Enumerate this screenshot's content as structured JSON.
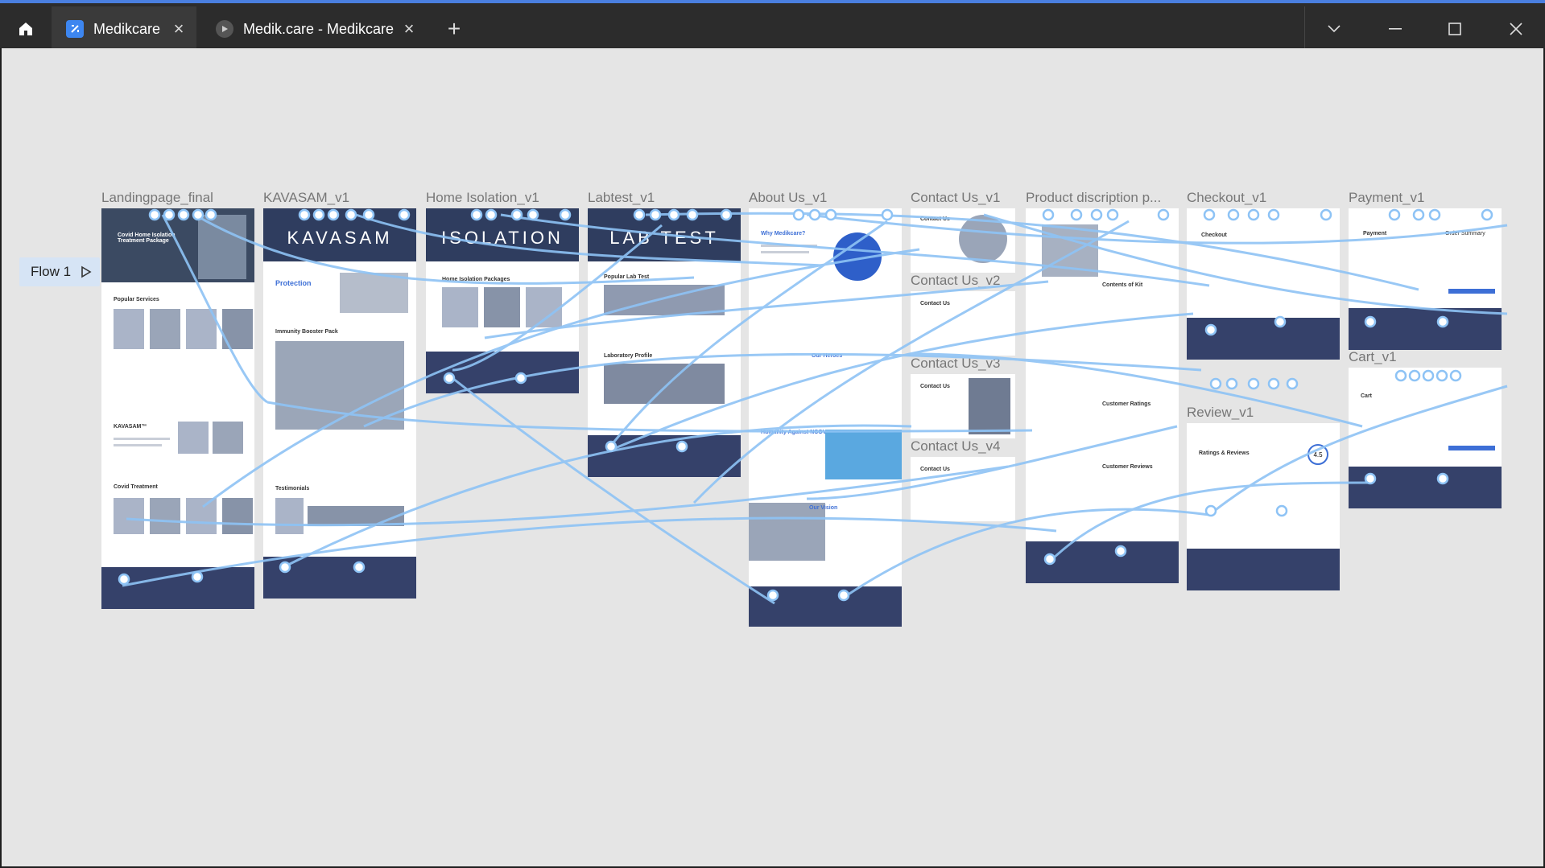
{
  "browser": {
    "tabs": [
      {
        "label": "Medikcare",
        "icon": "figma-file-icon",
        "active": true
      },
      {
        "label": "Medik.care - Medikcare",
        "icon": "play-icon",
        "active": false
      }
    ],
    "new_tab": "+"
  },
  "canvas": {
    "flow_label": "Flow 1",
    "frames": [
      {
        "title": "Landingpage_final",
        "hero": "Covid Home Isolation Treatment Package",
        "sections": [
          "Popular Services",
          "KAVASAM™",
          "Covid Treatment"
        ]
      },
      {
        "title": "KAVASAM_v1",
        "hero": "KAVASAM",
        "sections": [
          "Protection",
          "Immunity Booster Pack",
          "Testimonials"
        ]
      },
      {
        "title": "Home Isolation_v1",
        "hero": "ISOLATION",
        "sections": [
          "Home Isolation Packages"
        ]
      },
      {
        "title": "Labtest_v1",
        "hero": "LAB TEST",
        "sections": [
          "Popular Lab Test",
          "Laboratory Profile"
        ]
      },
      {
        "title": "About Us_v1",
        "hero": "Why Medikcare?",
        "sections": [
          "Our Heroes",
          "Humanity Against NCOVID",
          "Our Vision"
        ]
      },
      {
        "title": "Contact Us_v1",
        "hero": "Contact Us",
        "sections": []
      },
      {
        "title": "Contact Us_v2",
        "hero": "Contact Us",
        "sections": []
      },
      {
        "title": "Contact Us_v3",
        "hero": "Contact Us",
        "sections": []
      },
      {
        "title": "Contact Us_v4",
        "hero": "Contact Us",
        "sections": []
      },
      {
        "title": "Product discription p...",
        "hero": "",
        "sections": [
          "Contents of Kit",
          "Customer Ratings",
          "Customer Reviews"
        ]
      },
      {
        "title": "Checkout_v1",
        "hero": "Checkout",
        "sections": []
      },
      {
        "title": "Review_v1",
        "hero": "Ratings & Reviews",
        "sections": [
          "4.5"
        ]
      },
      {
        "title": "Payment_v1",
        "hero": "Payment",
        "sections": [
          "Order Summary"
        ]
      },
      {
        "title": "Cart_v1",
        "hero": "Cart",
        "sections": []
      }
    ]
  },
  "colors": {
    "accent": "#4a7fe0",
    "link": "#8ec3f5",
    "canvas": "#e5e5e5",
    "titlebar": "#2c2c2c"
  }
}
